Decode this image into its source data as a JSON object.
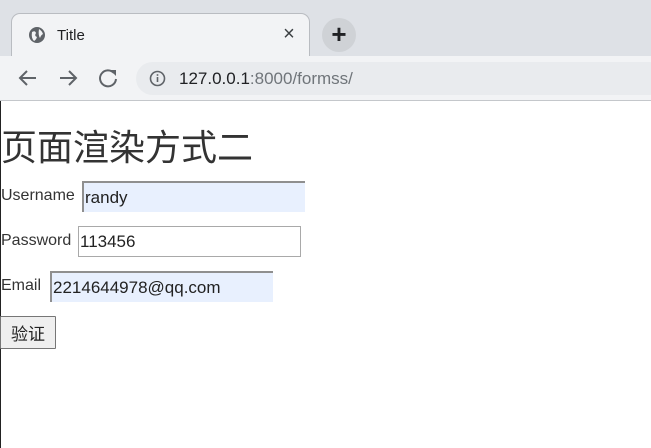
{
  "browser": {
    "tab_title": "Title",
    "close_symbol": "×",
    "new_tab_symbol": "+",
    "url_host": "127.0.0.1",
    "url_rest": ":8000/formss/"
  },
  "page": {
    "title": "页面渲染方式二",
    "form": {
      "username_label": "Username",
      "username_value": "randy",
      "password_label": "Password",
      "password_value": "113456",
      "email_label": "Email",
      "email_value": "2214644978@qq.com",
      "submit_label": "验证"
    }
  },
  "colors": {
    "tabstrip": "#dee1e6",
    "toolbar": "#f2f3f5",
    "autofill": "#e8f0fe"
  }
}
